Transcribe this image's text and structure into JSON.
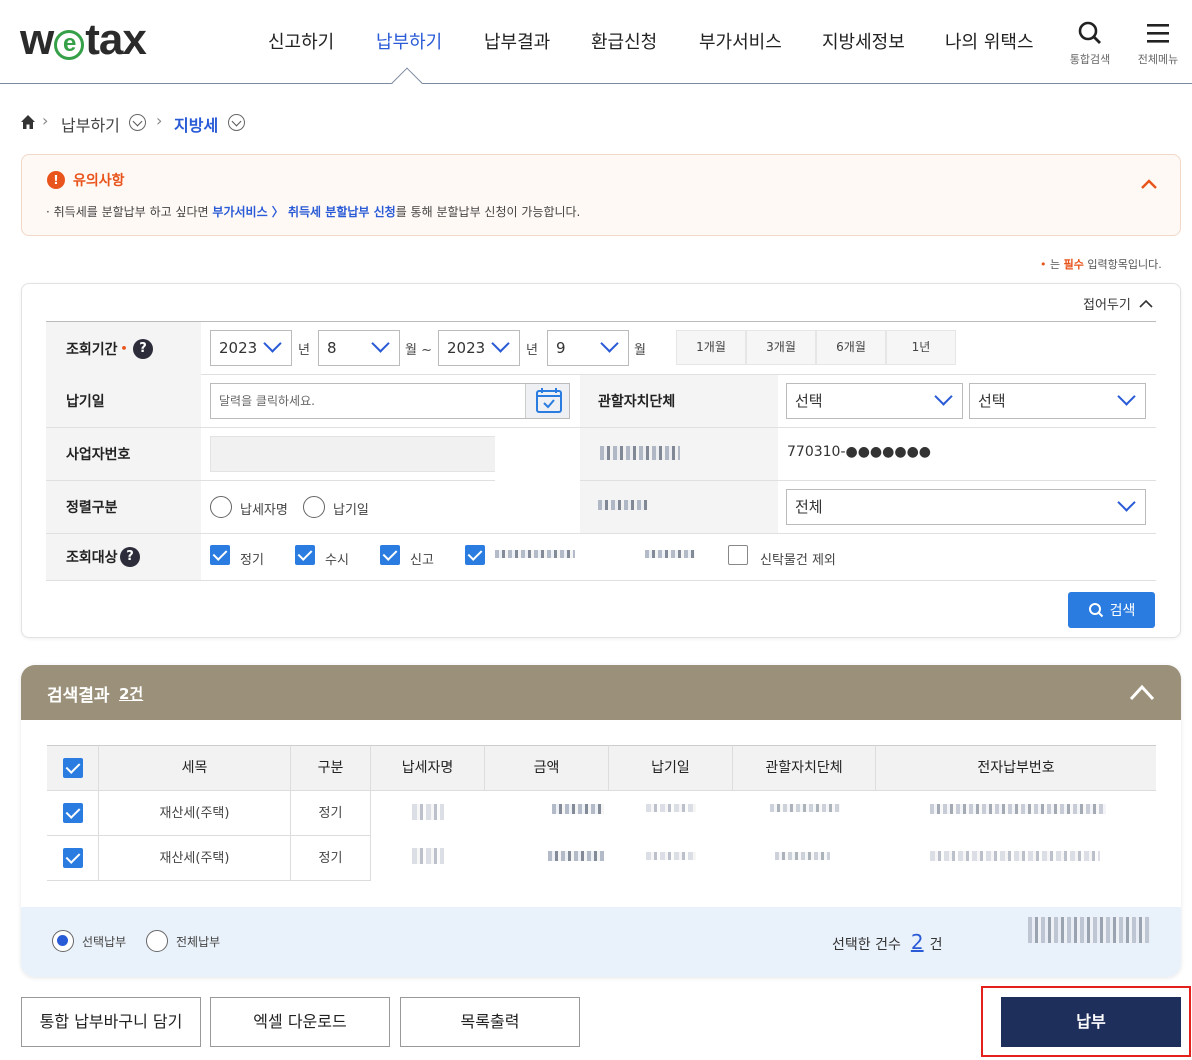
{
  "header": {
    "logo_pre": "w",
    "logo_e": "e",
    "logo_post": "tax",
    "nav": [
      "신고하기",
      "납부하기",
      "납부결과",
      "환급신청",
      "부가서비스",
      "지방세정보",
      "나의 위택스"
    ],
    "search_label": "통합검색",
    "menu_label": "전체메뉴"
  },
  "breadcrumb": {
    "level1": "납부하기",
    "level2": "지방세"
  },
  "notice": {
    "icon": "!",
    "title": "유의사항",
    "text_pre": "· 취득세를 분할납부 하고 싶다면 ",
    "text_link": "부가서비스 〉 취득세 분할납부 신청",
    "text_post": "를 통해 분할납부 신청이 가능합니다."
  },
  "required_note": {
    "dot": "•",
    "pre": " 는 ",
    "strong": "필수",
    "post": " 입력항목입니다."
  },
  "form": {
    "collapse_label": "접어두기",
    "period_label": "조회기간",
    "period_required": "•",
    "help": "?",
    "start_year": "2023",
    "start_month": "8",
    "end_year": "2023",
    "end_month": "9",
    "unit_year": "년",
    "unit_month_tilde": "월 ~",
    "unit_month": "월",
    "quick_periods": [
      "1개월",
      "3개월",
      "6개월",
      "1년"
    ],
    "due_date_label": "납기일",
    "due_date_placeholder": "달력을 클릭하세요.",
    "jurisdiction_label": "관할자치단체",
    "jurisdiction_sel1": "선택",
    "jurisdiction_sel2": "선택",
    "bizno_label": "사업자번호",
    "id_value": "770310-●●●●●●●",
    "sort_label": "정렬구분",
    "sort_options": [
      "납세자명",
      "납기일"
    ],
    "all_select": "전체",
    "target_label": "조회대상",
    "target_options": [
      "정기",
      "수시",
      "신고"
    ],
    "exclude_trust": "신탁물건 제외",
    "search_button": "검색"
  },
  "results": {
    "title": "검색결과",
    "count": "2건",
    "columns": [
      "세목",
      "구분",
      "납세자명",
      "금액",
      "납기일",
      "관할자치단체",
      "전자납부번호"
    ],
    "rows": [
      {
        "tax": "재산세(주택)",
        "type": "정기"
      },
      {
        "tax": "재산세(주택)",
        "type": "정기"
      }
    ],
    "pay_options": [
      "선택납부",
      "전체납부"
    ],
    "selected_count_label": "선택한 건수",
    "selected_count": "2",
    "selected_count_unit": "건"
  },
  "buttons": {
    "cart": "통합 납부바구니 담기",
    "excel": "엑셀 다운로드",
    "print": "목록출력",
    "pay": "납부"
  },
  "colors": {
    "accent": "#2a5bd7",
    "brand_green": "#35a047",
    "notice_orange": "#e8541b",
    "result_header": "#9b9079",
    "pay_button": "#1f2f5c",
    "highlight_box": "#e3201b"
  }
}
